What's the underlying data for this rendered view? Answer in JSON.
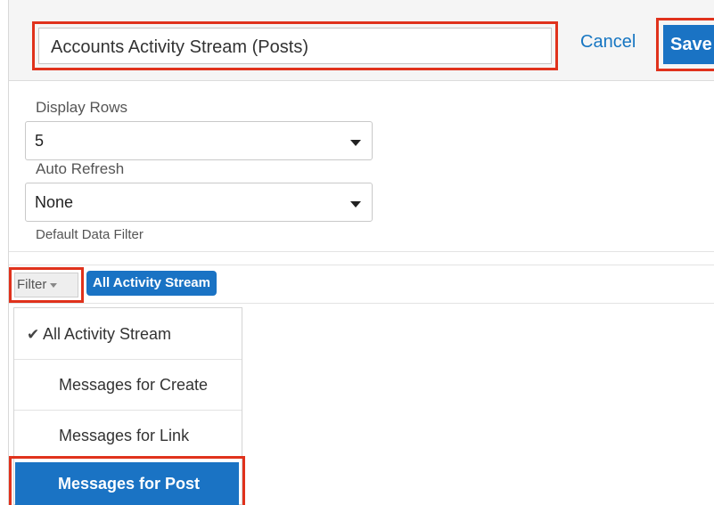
{
  "header": {
    "title_value": "Accounts Activity Stream (Posts)",
    "cancel_label": "Cancel",
    "save_label": "Save"
  },
  "form": {
    "display_rows": {
      "label": "Display Rows",
      "value": "5"
    },
    "auto_refresh": {
      "label": "Auto Refresh",
      "value": "None"
    },
    "default_filter_label": "Default Data Filter"
  },
  "filter": {
    "button_label": "Filter",
    "active_pill": "All Activity Stream",
    "menu_items": [
      {
        "label": "All Activity Stream",
        "checked": true
      },
      {
        "label": "Messages for Create"
      },
      {
        "label": "Messages for Link"
      },
      {
        "label": "Messages for Post",
        "highlighted": true
      }
    ]
  },
  "colors": {
    "accent": "#1a73c4",
    "highlight_border": "#e0321c"
  }
}
